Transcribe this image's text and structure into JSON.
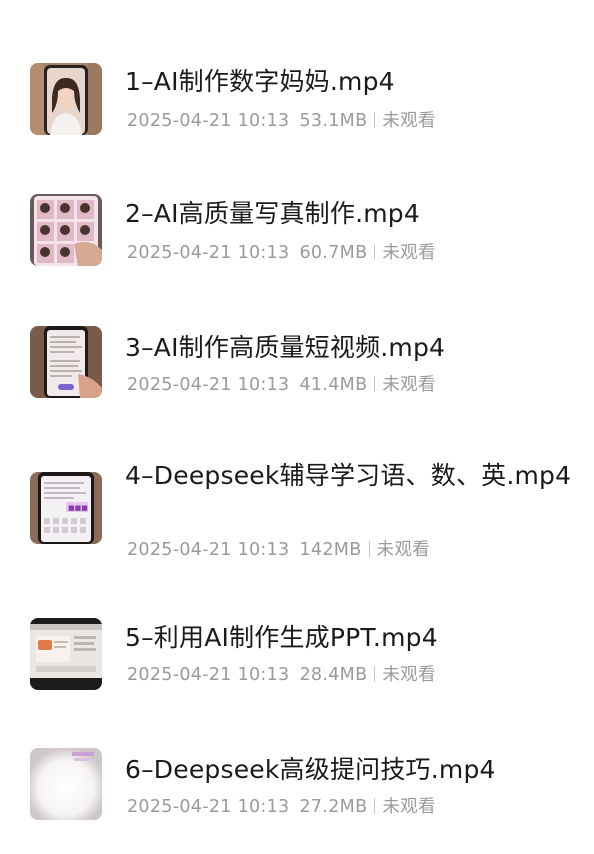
{
  "files": [
    {
      "name": "1–AI制作数字妈妈.mp4",
      "date": "2025-04-21 10:13",
      "size": "53.1MB",
      "status": "未观看",
      "thumb_icon": "portrait-video-thumbnail"
    },
    {
      "name": "2–AI高质量写真制作.mp4",
      "date": "2025-04-21 10:13",
      "size": "60.7MB",
      "status": "未观看",
      "thumb_icon": "photo-grid-video-thumbnail"
    },
    {
      "name": "3–AI制作高质量短视频.mp4",
      "date": "2025-04-21 10:13",
      "size": "41.4MB",
      "status": "未观看",
      "thumb_icon": "phone-screen-video-thumbnail"
    },
    {
      "name": "4–Deepseek辅导学习语、数、英.mp4",
      "date": "2025-04-21 10:13",
      "size": "142MB",
      "status": "未观看",
      "thumb_icon": "phone-app-video-thumbnail"
    },
    {
      "name": "5–利用AI制作生成PPT.mp4",
      "date": "2025-04-21 10:13",
      "size": "28.4MB",
      "status": "未观看",
      "thumb_icon": "laptop-screen-video-thumbnail"
    },
    {
      "name": "6–Deepseek高级提问技巧.mp4",
      "date": "2025-04-21 10:13",
      "size": "27.2MB",
      "status": "未观看",
      "thumb_icon": "blank-video-thumbnail"
    }
  ]
}
